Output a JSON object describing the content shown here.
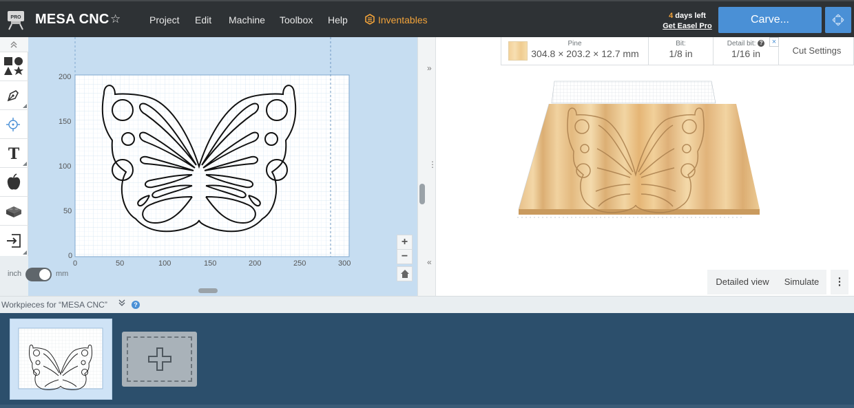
{
  "app": {
    "project_name": "MESA CNC",
    "favorite_icon": "star-outline-icon",
    "pro_badge": "PRO"
  },
  "menu": {
    "items": [
      "Project",
      "Edit",
      "Machine",
      "Toolbox",
      "Help"
    ],
    "inventables": "Inventables"
  },
  "trial": {
    "days": "4",
    "days_suffix": " days left",
    "cta": "Get Easel Pro"
  },
  "carve": {
    "label": "Carve..."
  },
  "tools": [
    {
      "name": "shapes-tool",
      "icon": "shapes-icon"
    },
    {
      "name": "pen-tool",
      "icon": "pen-icon"
    },
    {
      "name": "point-tool",
      "icon": "crosshair-icon"
    },
    {
      "name": "text-tool",
      "icon": "text-T-icon"
    },
    {
      "name": "icon-library-tool",
      "icon": "apple-icon"
    },
    {
      "name": "apps-tool",
      "icon": "lego-brick-icon"
    },
    {
      "name": "import-tool",
      "icon": "import-icon"
    }
  ],
  "canvas": {
    "y_ticks": [
      "200",
      "150",
      "100",
      "50",
      "0"
    ],
    "x_ticks": [
      "0",
      "50",
      "100",
      "150",
      "200",
      "250",
      "300"
    ],
    "units": {
      "left": "inch",
      "right": "mm",
      "selected": "mm"
    },
    "zoom_in": "+",
    "zoom_out": "−"
  },
  "strip": {
    "collapse": "»",
    "expand": "«"
  },
  "material": {
    "name": "Pine",
    "dimensions": "304.8 × 203.2 × 12.7 mm",
    "swatch_color": "#f3d19a"
  },
  "bit": {
    "label": "Bit:",
    "value": "1/8 in"
  },
  "detail_bit": {
    "label": "Detail bit:",
    "value": "1/16 in",
    "help": "?",
    "close": "×"
  },
  "cut_settings": "Cut Settings",
  "preview_buttons": {
    "detailed": "Detailed view",
    "simulate": "Simulate"
  },
  "workpieces": {
    "title": "Workpieces for “MESA CNC”",
    "chevron": "≫",
    "help": "?"
  },
  "colors": {
    "accent": "#4a90d6",
    "inventables": "#f2a33a",
    "topbar": "#2e3235",
    "workpiece_bg": "#2c4f6c"
  }
}
